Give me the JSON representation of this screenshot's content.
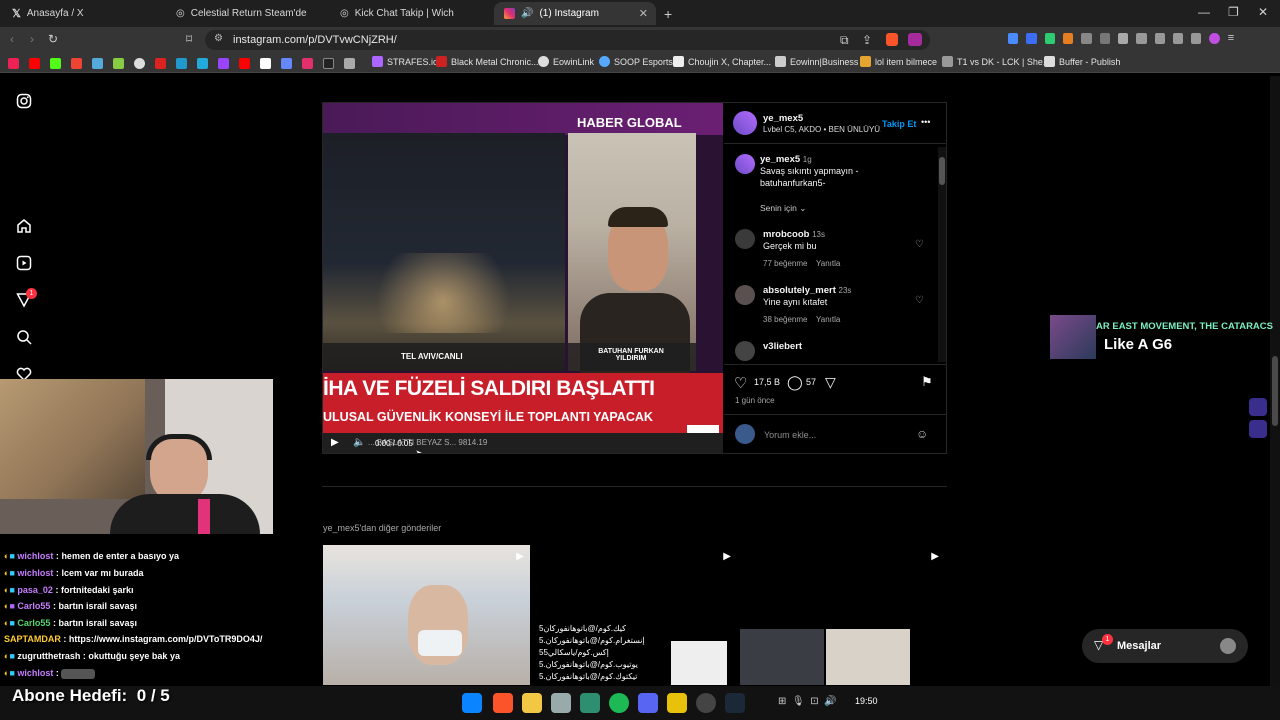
{
  "tabs": [
    {
      "label": "Anasayfa / X",
      "color": "#ffffff"
    },
    {
      "label": "Celestial Return Steam'de",
      "color": "#c8c8c8"
    },
    {
      "label": "Kick Chat Takip | Wich",
      "color": "#c8c8c8"
    },
    {
      "label": "(1) Instagram",
      "color": "#e1306c"
    }
  ],
  "url": "instagram.com/p/DVTvwCNjZRH/",
  "bookmarks": [
    "STRAFES.io",
    "Black Metal Chronic...",
    "EowinLink",
    "SOOP Esports",
    "Choujin X, Chapter...",
    "Eowinn|Business",
    "lol item bilmece",
    "T1 vs DK - LCK | She...",
    "Buffer - Publish"
  ],
  "sidebar": {
    "notif_count": "1"
  },
  "video": {
    "brand": "HABER GLOBAL",
    "location": "TEL AVIV/CANLI",
    "guest": "BATUHAN FURKAN",
    "guest_last": "YILDIRIM",
    "headline": "İHA VE FÜZELİ SALDIRI BAŞLATTI",
    "subheadline": "ULUSAL GÜVENLİK KONSEYİ İLE TOPLANTI YAPACAK",
    "ticker": "... BAŞLATTI     BEYAZ S...     9814.19",
    "logo": "HG",
    "time": "0:00 / 0:05"
  },
  "post": {
    "username": "ye_mex5",
    "subtitle": "Lvbel C5, AKDO • BEN ÜNLÜYÜ...",
    "follow": "Takip Et",
    "more": "•••",
    "caption_user": "ye_mex5",
    "caption_time": "1g",
    "caption_line1": "Savaş sıkıntı yapmayın -",
    "caption_line2": "batuhanfurkan5-",
    "sort": "Senin için",
    "comments": [
      {
        "user": "mrobcoob",
        "time": "13s",
        "text": "Gerçek mi bu",
        "likes": "77 beğenme",
        "reply": "Yanıtla"
      },
      {
        "user": "absolutely_mert",
        "time": "23s",
        "text": "Yine aynı kıtafet",
        "likes": "38 beğenme",
        "reply": "Yanıtla"
      },
      {
        "user": "v3liebert",
        "time": "",
        "text": "",
        "likes": "",
        "reply": ""
      }
    ],
    "like_count": "17,5 B",
    "comment_count": "57",
    "posted": "1 gün önce",
    "comment_placeholder": "Yorum ekle..."
  },
  "more_posts_label": "ye_mex5'dan diğer gönderiler",
  "thumb2_lines": [
    "كيك.كوم/@باتوهانفوركان5",
    "إنستغرام.كوم/@باتوهانفوركان.5",
    "إكس.كوم/ياسكالي55",
    "يوتيوب.كوم/@باتوهانفوركان.5",
    "تيكتوك.كوم/@باتوهانفوركان.5"
  ],
  "now_playing": {
    "artist": "AR EAST MOVEMENT, THE CATARACS",
    "title": "Like A G6"
  },
  "messages": {
    "label": "Mesajlar",
    "count": "1"
  },
  "chat": [
    {
      "user": "wichlost",
      "sep": ":",
      "text": "hemen de enter a basıyo ya",
      "color": "#c77dff"
    },
    {
      "user": "wichlost",
      "sep": ":",
      "text": "lcem var mı burada",
      "color": "#c77dff"
    },
    {
      "user": "pasa_02",
      "sep": ":",
      "text": "fortnitedaki şarkı",
      "color": "#c77dff"
    },
    {
      "user": "Carlo55",
      "sep": ":",
      "text": "bartın israil savaşı",
      "color": "#55d66b"
    },
    {
      "user": "SAPTAMDAR",
      "sep": ":",
      "text": "https://www.instagram.com/p/DVToTR9DO4J/",
      "color": "#ffcc33"
    },
    {
      "user": "zugrutthetrash",
      "sep": ":",
      "text": "okuttuğu şeye bak ya",
      "color": "#ffffff"
    },
    {
      "user": "wichlost",
      "sep": ":",
      "text": "",
      "color": "#c77dff"
    }
  ],
  "goal": {
    "label": "Abone Hedefi:",
    "value": "0 / 5"
  },
  "clock": "19:50"
}
